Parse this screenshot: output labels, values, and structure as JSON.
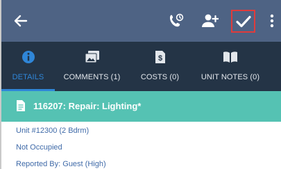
{
  "toolbar": {
    "back_icon": "arrow-left-icon",
    "call_icon": "phone-clock-icon",
    "assign_icon": "person-add-icon",
    "complete_icon": "checkmark-icon",
    "more_icon": "more-vertical-icon",
    "highlight_color": "#e03b3b"
  },
  "tabs": [
    {
      "label": "DETAILS",
      "icon": "info-circle-icon",
      "active": true
    },
    {
      "label": "COMMENTS (1)",
      "icon": "image-gallery-icon",
      "active": false
    },
    {
      "label": "COSTS (0)",
      "icon": "dollar-document-icon",
      "active": false
    },
    {
      "label": "UNIT NOTES (0)",
      "icon": "open-book-icon",
      "active": false
    }
  ],
  "work_order": {
    "icon": "document-icon",
    "title": "116207: Repair: Lighting*"
  },
  "details": {
    "unit": "Unit #12300 (2 Bdrm)",
    "occupancy": "Not Occupied",
    "reported_by": "Reported By: Guest  (High)"
  },
  "colors": {
    "appbar": "#4e6384",
    "tabbar": "#243446",
    "accent": "#2f86d8",
    "header": "#55c2b3",
    "detail_text": "#3f6aa8"
  }
}
